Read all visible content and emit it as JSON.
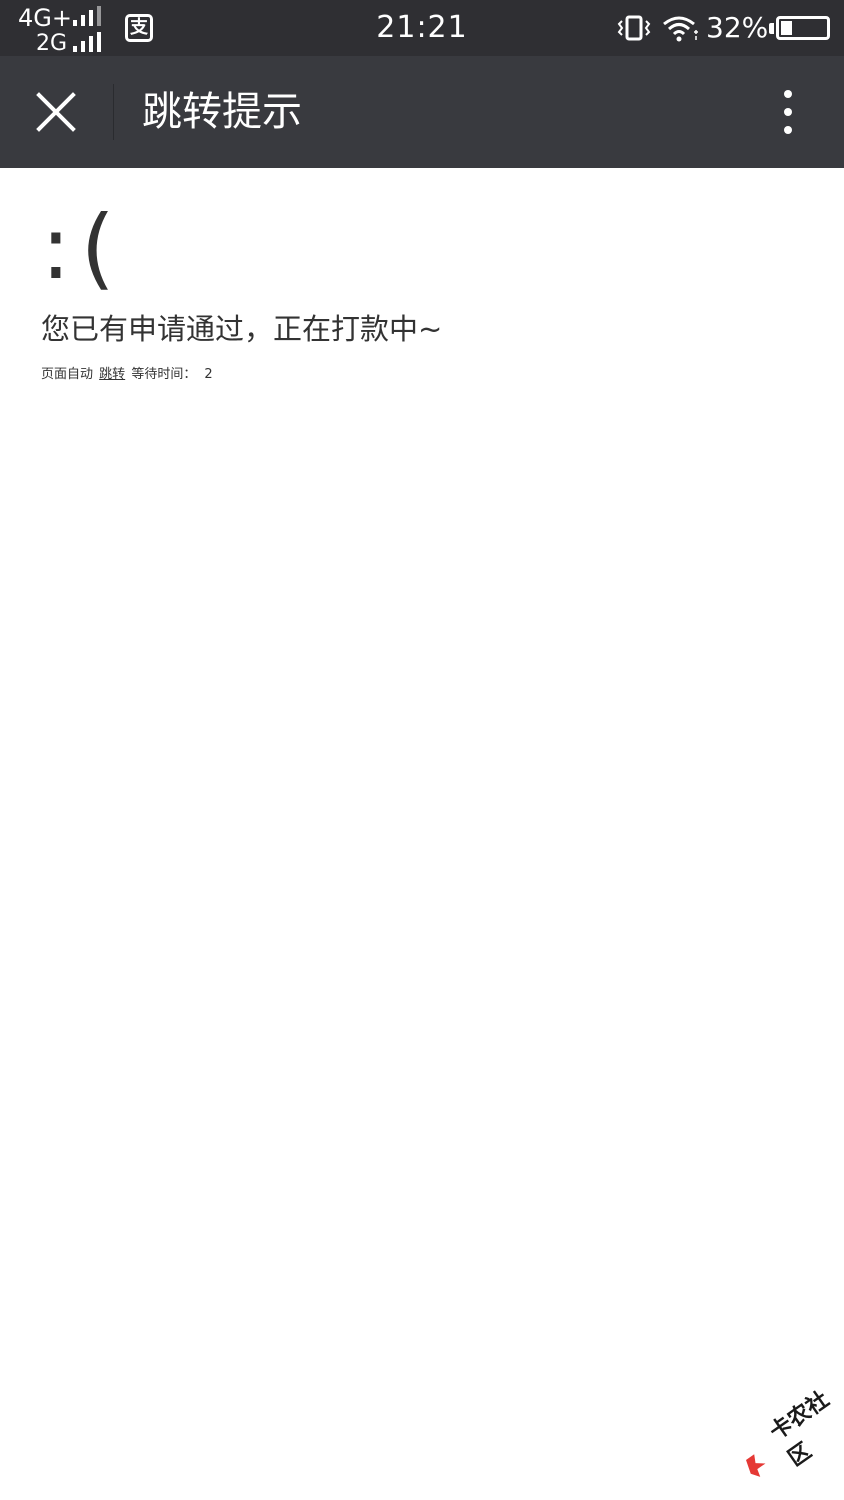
{
  "status_bar": {
    "network_primary": "4G+",
    "network_secondary": "2G",
    "time": "21:21",
    "battery_percent": "32%",
    "battery_level": 0.32,
    "icons": [
      "signal-icon",
      "alipay-icon",
      "vibrate-icon",
      "wifi-icon",
      "battery-icon"
    ]
  },
  "title_bar": {
    "title": "跳转提示",
    "close_icon": "close-icon",
    "more_icon": "more-vertical-icon"
  },
  "main": {
    "face": ":(",
    "message": "您已有申请通过，正在打款中~",
    "auto_prefix": "页面自动",
    "jump_link": "跳转",
    "wait_label": "等待时间：",
    "countdown": "2"
  },
  "watermark": {
    "text": "卡农社区"
  },
  "colors": {
    "status_bar_bg": "#2f2f33",
    "title_bar_bg": "#393a3f",
    "page_bg": "#ffffff",
    "text": "#333333"
  }
}
